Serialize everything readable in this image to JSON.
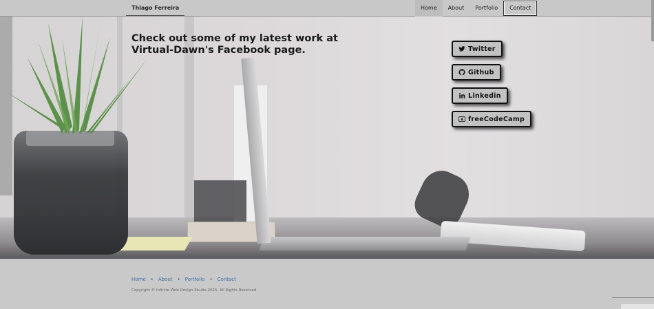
{
  "navbar": {
    "brand": "Thiago Ferreira",
    "items": [
      {
        "label": "Home"
      },
      {
        "label": "About"
      },
      {
        "label": "Portfolio"
      },
      {
        "label": "Contact"
      }
    ]
  },
  "hero": {
    "line1": "Check out some of my latest work at",
    "line2": "Virtual-Dawn's Facebook page."
  },
  "social": {
    "twitter": {
      "label": "Twitter",
      "icon": "twitter-icon"
    },
    "github": {
      "label": "Github",
      "icon": "github-icon"
    },
    "linkedin": {
      "label": "Linkedin",
      "icon": "linkedin-icon"
    },
    "freecodecamp": {
      "label": "freeCodeCamp",
      "icon": "freecodecamp-icon"
    }
  },
  "footer": {
    "links": [
      {
        "label": "Home"
      },
      {
        "label": "About"
      },
      {
        "label": "Portfolio"
      },
      {
        "label": "Contact"
      }
    ],
    "separator": "•",
    "copyright": "Copyright © Infinito Web Design Studio 2015. All Rights Reserved"
  },
  "colors": {
    "link": "#3b6fa8",
    "button_border": "#111111"
  }
}
